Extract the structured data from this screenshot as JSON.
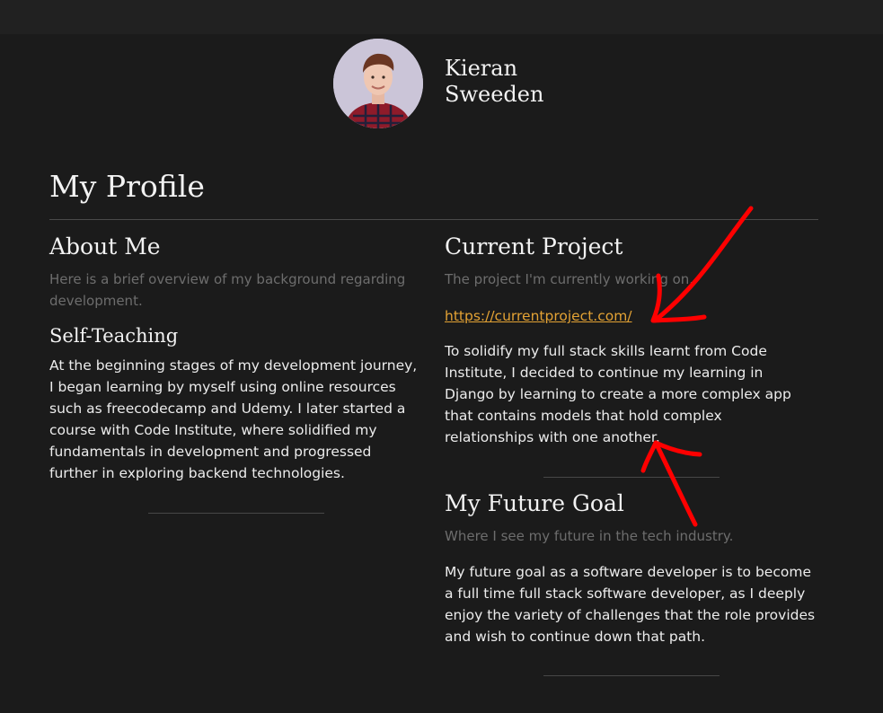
{
  "header": {
    "name_first": "Kieran",
    "name_last": "Sweeden"
  },
  "page": {
    "title": "My Profile"
  },
  "about": {
    "heading": "About Me",
    "subtitle": "Here is a brief overview of my background regarding development.",
    "section_heading": "Self-Teaching",
    "body": "At the beginning stages of my development journey, I began learning by myself using online resources such as freecodecamp and Udemy. I later started a course with Code Institute, where solidified my fundamentals in development and progressed further in exploring backend technologies."
  },
  "current_project": {
    "heading": "Current Project",
    "subtitle": "The project I'm currently working on.",
    "link_text": "https://currentproject.com/",
    "body": "To solidify my full stack skills learnt from Code Institute, I decided to continue my learning in Django by learning to create a more complex app that contains models that hold complex relationships with one another."
  },
  "future_goal": {
    "heading": "My Future Goal",
    "subtitle": "Where I see my future in the tech industry.",
    "body": "My future goal as a software developer is to become a full time full stack software developer, as I deeply enjoy the variety of challenges that the role provides and wish to continue down that path."
  },
  "colors": {
    "background": "#1b1b1b",
    "link": "#e3a234",
    "annotation": "#ff0000"
  }
}
